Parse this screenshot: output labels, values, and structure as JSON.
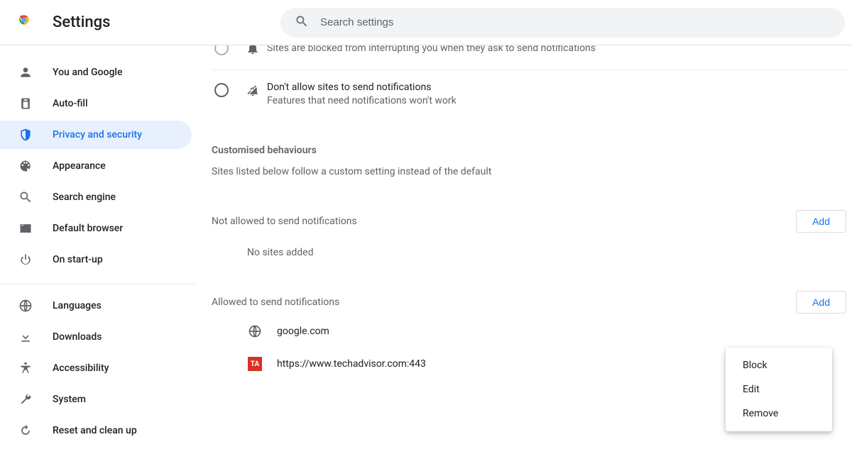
{
  "header": {
    "title": "Settings",
    "search_placeholder": "Search settings"
  },
  "sidebar": {
    "items": [
      {
        "label": "You and Google",
        "icon": "person-icon"
      },
      {
        "label": "Auto-fill",
        "icon": "autofill-icon"
      },
      {
        "label": "Privacy and security",
        "icon": "shield-icon",
        "active": true
      },
      {
        "label": "Appearance",
        "icon": "palette-icon"
      },
      {
        "label": "Search engine",
        "icon": "search-icon"
      },
      {
        "label": "Default browser",
        "icon": "browser-icon"
      },
      {
        "label": "On start-up",
        "icon": "power-icon"
      }
    ],
    "items2": [
      {
        "label": "Languages",
        "icon": "globe-icon"
      },
      {
        "label": "Downloads",
        "icon": "download-icon"
      },
      {
        "label": "Accessibility",
        "icon": "accessibility-icon"
      },
      {
        "label": "System",
        "icon": "wrench-icon"
      },
      {
        "label": "Reset and clean up",
        "icon": "restore-icon"
      }
    ]
  },
  "main": {
    "options": [
      {
        "title": "",
        "sub": "Sites are blocked from interrupting you when they ask to send notifications",
        "icon": "bell-icon"
      },
      {
        "title": "Don't allow sites to send notifications",
        "sub": "Features that need notifications won't work",
        "icon": "bell-off-icon"
      }
    ],
    "customised_title": "Customised behaviours",
    "customised_sub": "Sites listed below follow a custom setting instead of the default",
    "not_allowed": {
      "label": "Not allowed to send notifications",
      "add": "Add",
      "empty": "No sites added"
    },
    "allowed": {
      "label": "Allowed to send notifications",
      "add": "Add",
      "sites": [
        {
          "url": "google.com",
          "icon_kind": "globe"
        },
        {
          "url": "https://www.techadvisor.com:443",
          "icon_kind": "ta"
        }
      ]
    },
    "context_menu": {
      "block": "Block",
      "edit": "Edit",
      "remove": "Remove"
    }
  }
}
